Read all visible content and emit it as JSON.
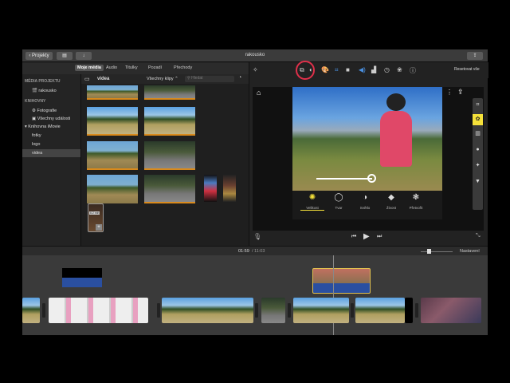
{
  "window": {
    "title": "rakousko",
    "back_label": "Projekty",
    "reset_label": "Resetovat vše"
  },
  "tabs": [
    {
      "label": "Moje média"
    },
    {
      "label": "Audio"
    },
    {
      "label": "Titulky"
    },
    {
      "label": "Pozadí"
    },
    {
      "label": "Přechody"
    }
  ],
  "sidebar": {
    "section1": "MÉDIA PROJEKTU",
    "project": "rakousko",
    "section2": "KNIHOVNY",
    "items": [
      {
        "label": "Fotografie"
      },
      {
        "label": "Všechny události"
      },
      {
        "label": "Knihovna iMovie"
      },
      {
        "label": "fotky"
      },
      {
        "label": "logo"
      },
      {
        "label": "videa"
      }
    ]
  },
  "browser": {
    "folder": "videa",
    "filter": "Všechny klipy",
    "search_placeholder": "Hledat",
    "tooltip": "6,2 min"
  },
  "adjust": [
    {
      "label": "Velikost"
    },
    {
      "label": "Tvar"
    },
    {
      "label": "Světlo"
    },
    {
      "label": "Živost"
    },
    {
      "label": "Přetvořit"
    }
  ],
  "timeline": {
    "current": "01:59",
    "total": "/ 11:03",
    "settings": "Nastavení"
  },
  "colors": {
    "accent": "#f5e13a",
    "highlight": "#e0304a",
    "timeline_audio": "#2a4fa0"
  }
}
